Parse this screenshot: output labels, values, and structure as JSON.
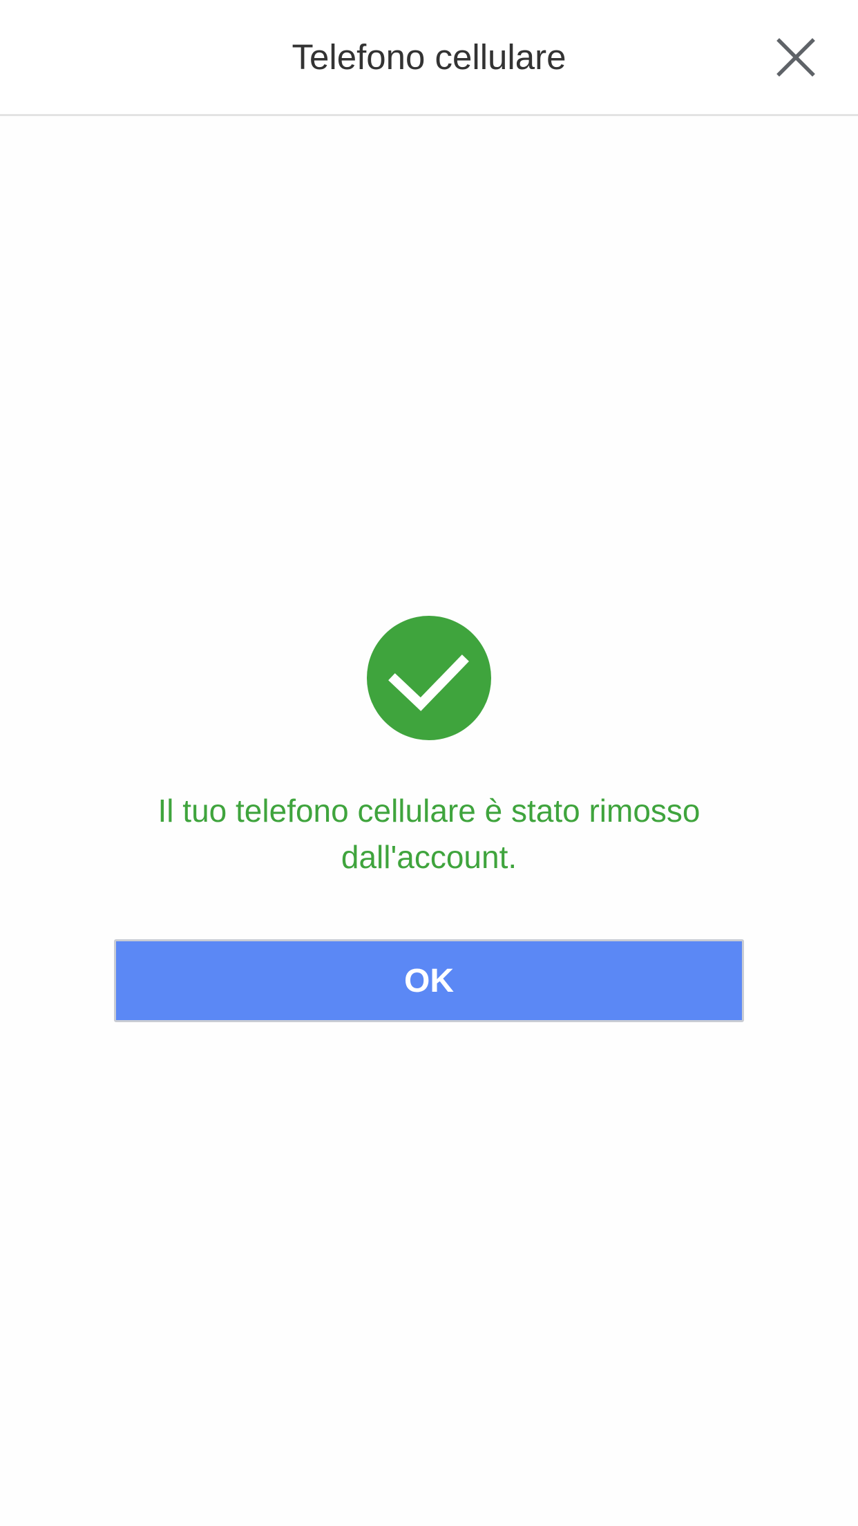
{
  "header": {
    "title": "Telefono cellulare",
    "close_icon": "close-icon"
  },
  "status": {
    "icon": "check-circle-icon",
    "color": "#3fa43d",
    "message": "Il tuo telefono cellulare è stato rimosso dall'account."
  },
  "actions": {
    "ok_label": "OK",
    "ok_color": "#5b88f5"
  }
}
